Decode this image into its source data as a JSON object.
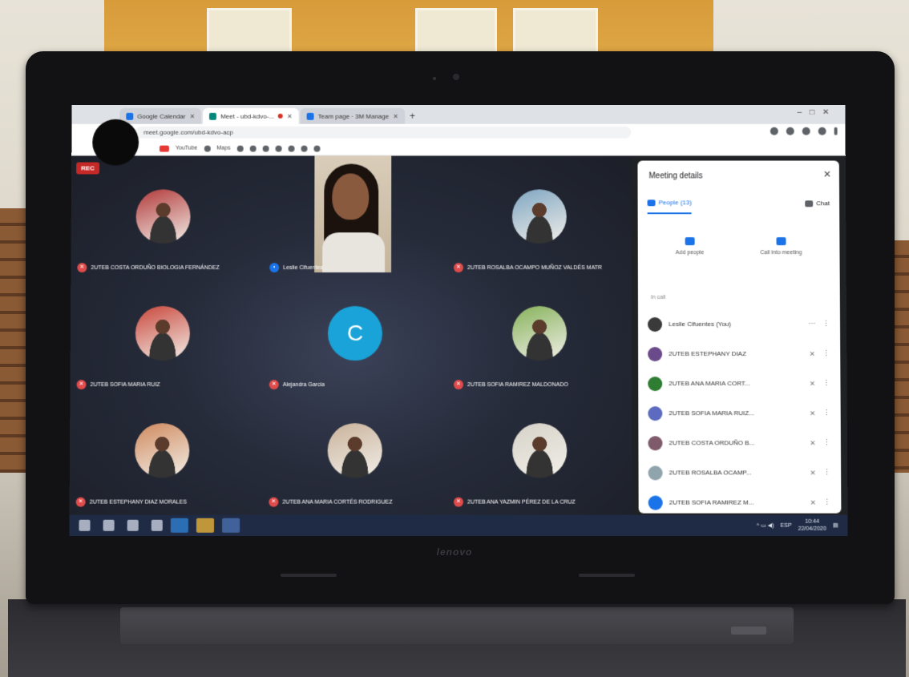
{
  "browser": {
    "tabs": [
      {
        "label": "Google Calendar",
        "active": false
      },
      {
        "label": "Meet - ubd-kdvo-...",
        "active": true
      },
      {
        "label": "Team page · 3M Manage",
        "active": false
      }
    ],
    "url": "meet.google.com/ubd-kdvo-acp",
    "bookmarks": [
      "YouTube",
      "Maps"
    ]
  },
  "meet": {
    "rec_label": "REC",
    "tiles": [
      {
        "name": "2UTEB COSTA ORDUÑO BIOLOGIA FERNÁNDEZ",
        "kind": "photo",
        "color": "#b23a3a"
      },
      {
        "name": "Leslie Cifuentes",
        "kind": "camera"
      },
      {
        "name": "2UTEB ROSALBA OCAMPO MUÑOZ VALDÉS MATR",
        "kind": "photo",
        "color": "#7fa6c2"
      },
      {
        "name": "2UTEB SOFIA MARIA RUIZ",
        "kind": "photo",
        "color": "#c9473c"
      },
      {
        "name": "Alejandra Garcia",
        "kind": "letter",
        "letter": "C"
      },
      {
        "name": "2UTEB SOFIA RAMIREZ MALDONADO",
        "kind": "photo",
        "color": "#86b25a"
      },
      {
        "name": "2UTEB ESTEPHANY DIAZ MORALES",
        "kind": "photo",
        "color": "#d08a5e"
      },
      {
        "name": "2UTEB ANA MARIA CORTÉS RODRIGUEZ",
        "kind": "photo",
        "color": "#c9b29a"
      },
      {
        "name": "2UTEB ANA YAZMIN PÉREZ DE LA CRUZ",
        "kind": "photo",
        "color": "#d6d2c8"
      }
    ]
  },
  "panel": {
    "title": "Meeting details",
    "tab_people": "People (13)",
    "tab_chat": "Chat",
    "action_add": "Add people",
    "action_call": "Call into meeting",
    "section": "In call",
    "people": [
      {
        "name": "Leslie Cifuentes (You)",
        "color": "#3a3a3a",
        "mic": "on"
      },
      {
        "name": "2UTEB ESTEPHANY DIAZ",
        "color": "#6a4a8a",
        "mic": "off"
      },
      {
        "name": "2UTEB ANA MARIA CORT...",
        "color": "#2e7d32",
        "mic": "off"
      },
      {
        "name": "2UTEB SOFIA MARIA RUIZ...",
        "color": "#5c6bc0",
        "mic": "off"
      },
      {
        "name": "2UTEB COSTA ORDUÑO B...",
        "color": "#7e5a6a",
        "mic": "off"
      },
      {
        "name": "2UTEB ROSALBA OCAMP...",
        "color": "#90a4ae",
        "mic": "off"
      },
      {
        "name": "2UTEB SOFIA RAMIREZ M...",
        "color": "#1a73e8",
        "mic": "off"
      }
    ]
  },
  "taskbar": {
    "time": "10:44",
    "date": "22/04/2020",
    "lang": "ESP"
  },
  "laptop": {
    "brand": "lenovo"
  }
}
